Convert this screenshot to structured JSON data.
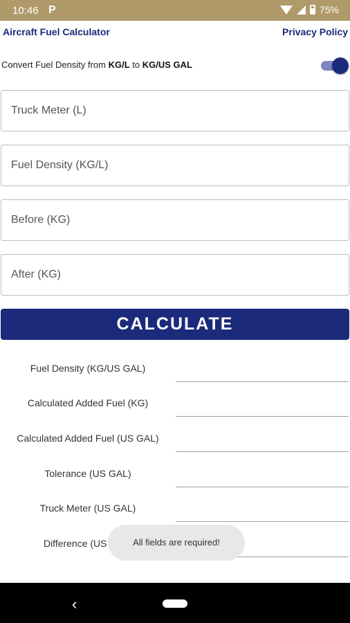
{
  "status_bar": {
    "time": "10:46",
    "notification_icon": "P",
    "battery": "75%"
  },
  "header": {
    "title": "Aircraft Fuel Calculator",
    "privacy_link": "Privacy Policy"
  },
  "convert": {
    "prefix": "Convert Fuel Density from ",
    "from": "KG/L",
    "to_word": " to ",
    "to": "KG/US GAL",
    "toggle_on": true
  },
  "inputs": {
    "truck_meter": {
      "placeholder": "Truck Meter (L)",
      "value": ""
    },
    "fuel_density": {
      "placeholder": "Fuel Density (KG/L)",
      "value": ""
    },
    "before": {
      "placeholder": "Before (KG)",
      "value": ""
    },
    "after": {
      "placeholder": "After (KG)",
      "value": ""
    }
  },
  "calculate_label": "CALCULATE",
  "results": [
    {
      "label": "Fuel Density (KG/US GAL)",
      "value": ""
    },
    {
      "label": "Calculated Added Fuel (KG)",
      "value": ""
    },
    {
      "label": "Calculated Added Fuel (US GAL)",
      "value": ""
    },
    {
      "label": "Tolerance (US GAL)",
      "value": ""
    },
    {
      "label": "Truck Meter (US GAL)",
      "value": ""
    },
    {
      "label": "Difference (US GAL)",
      "value": ""
    }
  ],
  "toast": "All fields are required!",
  "colors": {
    "primary": "#1b2a7a",
    "status_bar": "#b09a6a",
    "toggle_track": "#7b85c0"
  },
  "icons": {
    "back": "back-arrow-icon",
    "home": "home-pill-icon"
  }
}
